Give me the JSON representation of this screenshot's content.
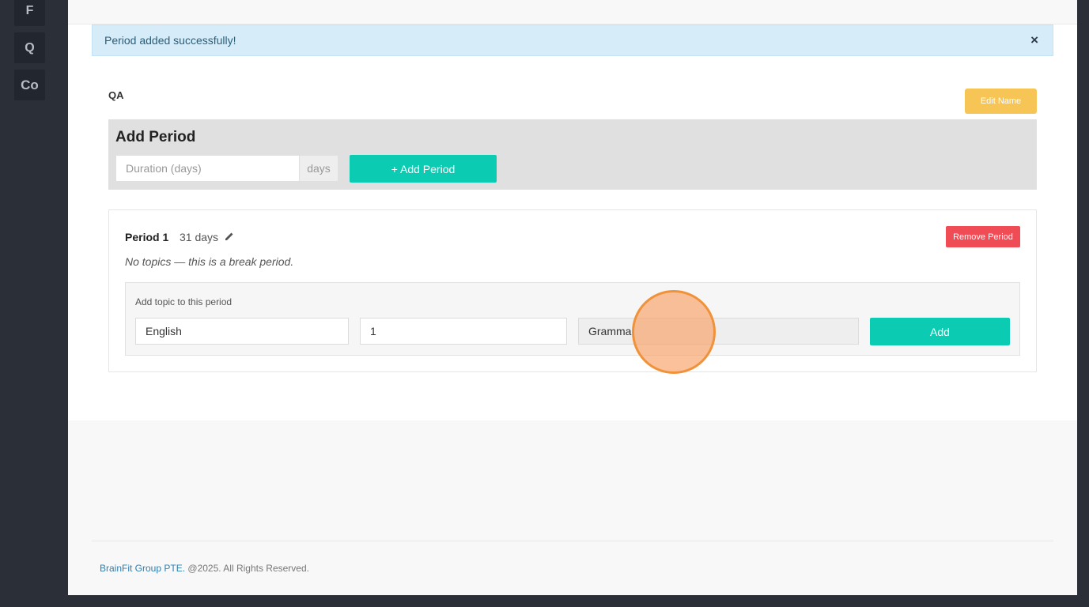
{
  "sidebar": {
    "items": [
      {
        "label": "F"
      },
      {
        "label": "Q"
      },
      {
        "label": "Co"
      }
    ]
  },
  "alert": {
    "message": "Period added successfully!",
    "close_glyph": "×"
  },
  "program": {
    "name": "QA",
    "edit_name_label": "Edit Name"
  },
  "add_period": {
    "title": "Add Period",
    "duration_placeholder": "Duration (days)",
    "days_addon": "days",
    "add_button_label": "+ Add Period"
  },
  "periods": [
    {
      "name": "Period 1",
      "duration": "31 days",
      "remove_label": "Remove Period",
      "empty_message": "No topics — this is a break period.",
      "add_topic": {
        "label": "Add topic to this period",
        "subject_value": "English",
        "number_value": "1",
        "topic_value": "Gramma",
        "add_button_label": "Add"
      }
    }
  ],
  "footer": {
    "brand": "BrainFit Group PTE.",
    "copyright": "@2025. All Rights Reserved."
  },
  "colors": {
    "accent_teal": "#0ccbb3",
    "warning_yellow": "#f6c556",
    "danger_red": "#ef4c55",
    "alert_bg": "#d6ecf8",
    "sidebar_bg": "#2a2f38"
  }
}
